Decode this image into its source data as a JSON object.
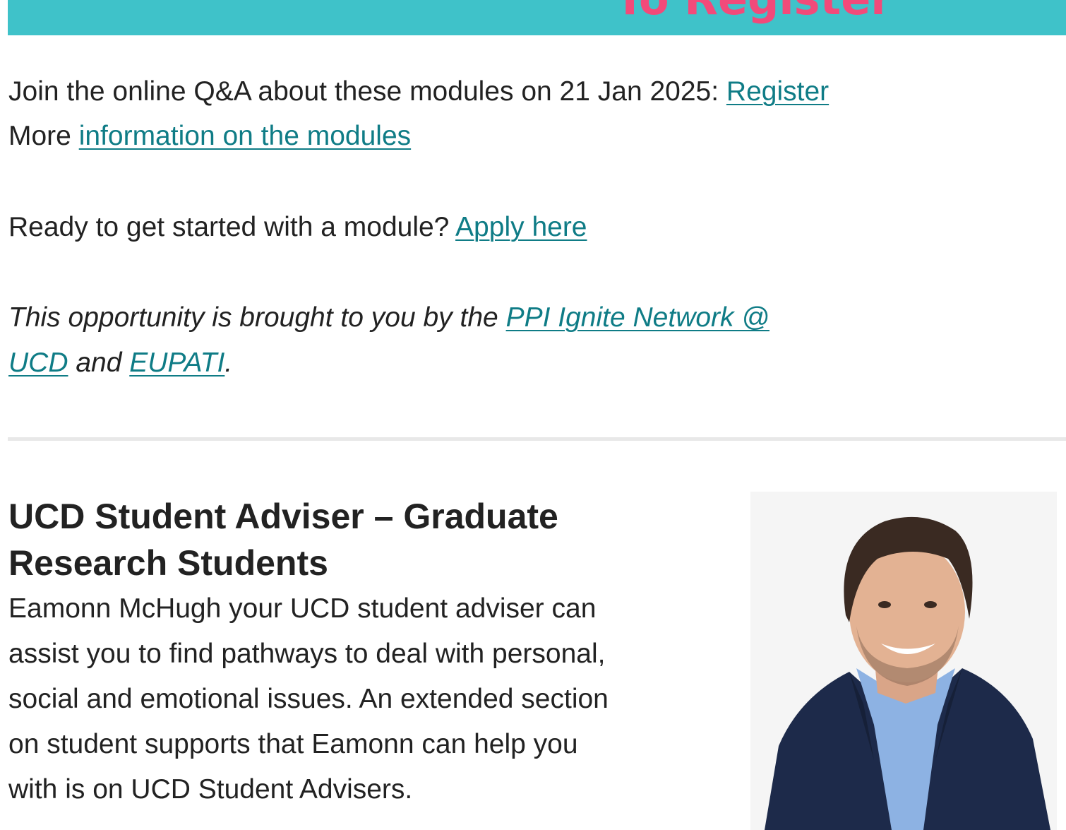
{
  "banner": {
    "text": "To Register",
    "background": "#3fc2c9",
    "text_color": "#f24a7a"
  },
  "qa_line": {
    "text": "Join the online Q&A about these modules on 21 Jan 2025: ",
    "link": "Register"
  },
  "more_line": {
    "text": "More ",
    "link": "information on the modules"
  },
  "apply_line": {
    "text": "Ready to get started with a module? ",
    "link": "Apply here"
  },
  "credit": {
    "prefix": "This opportunity is brought to you by the ",
    "link1_part1": "PPI Ignite Network @",
    "link1_part2": "UCD",
    "middle": " and ",
    "link2": "EUPATI",
    "suffix": "."
  },
  "adviser": {
    "heading_line1": "UCD Student Adviser – Graduate",
    "heading_line2": "Research Students",
    "body_line1": "Eamonn McHugh your UCD student adviser can",
    "body_line2": "assist you to find pathways to deal with personal,",
    "body_line3": "social and emotional issues. An extended section",
    "body_line4": "on student supports that Eamonn can help you",
    "body_line5": "with is on UCD Student Advisers.",
    "photo_icon": "person-photo-icon"
  },
  "colors": {
    "link": "#0f7c86",
    "divider": "#e8e8e8",
    "text": "#222222"
  }
}
